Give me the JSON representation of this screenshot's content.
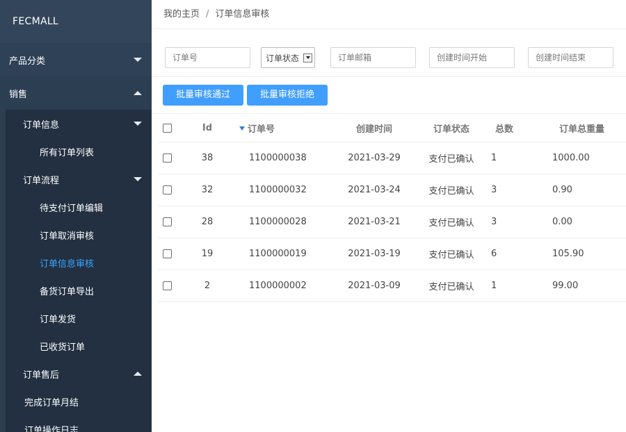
{
  "sidebar": {
    "brand": "FECMALL",
    "menu1": "产品分类",
    "menu2": "销售",
    "group1": "订单信息",
    "item_all_orders": "所有订单列表",
    "group2": "订单流程",
    "item_pending_edit": "待支付订单编辑",
    "item_cancel_review": "订单取消审核",
    "item_info_review": "订单信息审核",
    "item_stock_export": "备货订单导出",
    "item_ship": "订单发货",
    "item_received": "已收货订单",
    "group3": "订单售后",
    "item_monthly": "完成订单月结",
    "item_log": "订单操作日志"
  },
  "breadcrumb": {
    "home": "我的主页",
    "sep": "/",
    "current": "订单信息审核"
  },
  "filters": {
    "order_no_placeholder": "订单号",
    "status_selected": "订单状态",
    "email_placeholder": "订单邮箱",
    "created_start_placeholder": "创建时间开始",
    "created_end_placeholder": "创建时间结束"
  },
  "actions": {
    "approve": "批量审核通过",
    "reject": "批量审核拒绝"
  },
  "table": {
    "headers": {
      "id": "Id",
      "order_no": "订单号",
      "created": "创建时间",
      "status": "订单状态",
      "qty": "总数",
      "weight": "订单总重量"
    },
    "rows": [
      {
        "id": "38",
        "order_no": "1100000038",
        "created": "2021-03-29",
        "status": "支付已确认",
        "qty": "1",
        "weight": "1000.00"
      },
      {
        "id": "32",
        "order_no": "1100000032",
        "created": "2021-03-24",
        "status": "支付已确认",
        "qty": "3",
        "weight": "0.90"
      },
      {
        "id": "28",
        "order_no": "1100000028",
        "created": "2021-03-21",
        "status": "支付已确认",
        "qty": "3",
        "weight": "0.00"
      },
      {
        "id": "19",
        "order_no": "1100000019",
        "created": "2021-03-19",
        "status": "支付已确认",
        "qty": "6",
        "weight": "105.90"
      },
      {
        "id": "2",
        "order_no": "1100000002",
        "created": "2021-03-09",
        "status": "支付已确认",
        "qty": "1",
        "weight": "99.00"
      }
    ]
  },
  "colors": {
    "sidebar_bg": "#2c3e50",
    "accent": "#409eff",
    "active_link": "#3aa6ff"
  }
}
